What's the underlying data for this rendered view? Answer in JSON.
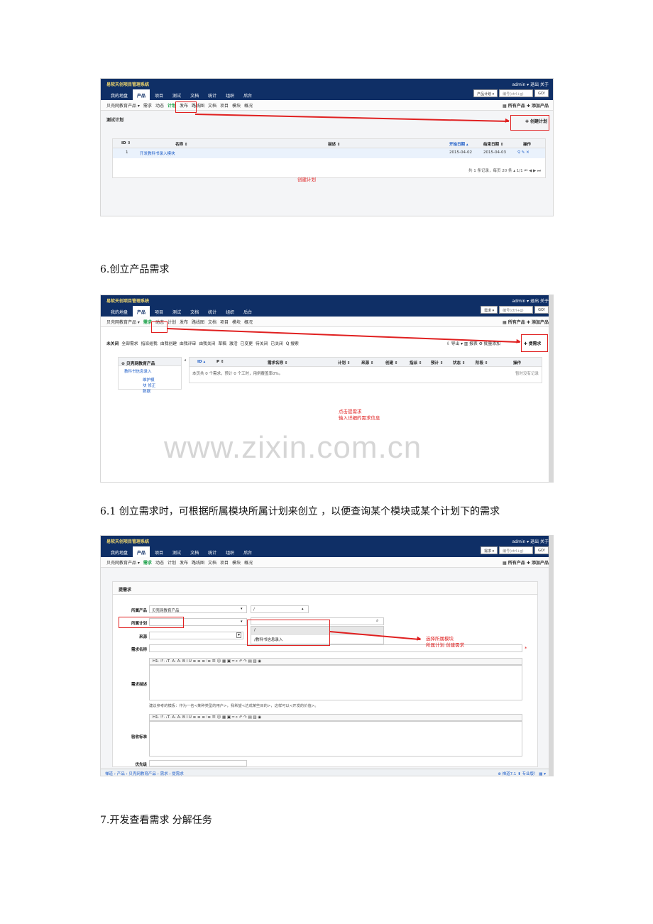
{
  "app": {
    "title": "易软天创项目管理系统",
    "user_menu": "admin ▾  退出  关于",
    "nav": [
      "我的地盘",
      "产品",
      "项目",
      "测试",
      "文档",
      "统计",
      "组织",
      "后台"
    ],
    "go": "GO!",
    "search_placeholder": "编号(ctrl+g)"
  },
  "shot1": {
    "search_type": "产品计划 ▾",
    "subnav": [
      "贝壳网教育产品 ▾",
      "需求",
      "动态",
      "计划",
      "发布",
      "路线图",
      "文档",
      "项目",
      "模块",
      "概况"
    ],
    "right_links": "▦ 所有产品  ✚ 添加产品",
    "panel_title": "测试计划",
    "create_btn": "✚ 创建计划",
    "columns": [
      "ID ⇕",
      "名称 ⇕",
      "描述 ⇕",
      "开始日期 ▴",
      "结束日期 ⇕",
      "操作"
    ],
    "row": [
      "1",
      "开发教科书录入模块",
      "",
      "2015-04-02",
      "2015-04-03",
      "⚲ ✎ ✕"
    ],
    "pager": "共 1 条记录，每页 20 条 ▴  1/1   ⏮  ◀  ▶  ⏭",
    "annotation": "创建计划"
  },
  "heading6": "6.创立产品需求",
  "shot2": {
    "search_type": "需求 ▾",
    "subnav": [
      "贝壳网教育产品 ▾",
      "需求",
      "动态",
      "计划",
      "发布",
      "路线图",
      "文档",
      "项目",
      "模块",
      "概况"
    ],
    "right_links": "▦ 所有产品  ✚ 添加产品",
    "filters": [
      "未关闭",
      "全部需求",
      "指派给我",
      "由我创建",
      "由我评审",
      "由我关闭",
      "草稿",
      "激活",
      "已变更",
      "待关闭",
      "已关闭",
      "Q 搜索"
    ],
    "actions": "⇩ 导出 ▾   ▥ 报表   ⚙ 批量添加",
    "create_btn": "✚ 提需求",
    "tree_title": "⊖ 贝壳网教育产品",
    "tree_item": "教科书信息录入",
    "tree_links": "维护模块 修正数据",
    "columns": [
      "ID ▴",
      "P ⇕",
      "需求名称 ⇕",
      "计划 ⇕",
      "来源 ⇕",
      "创建 ⇕",
      "指派 ⇕",
      "预计 ⇕",
      "状态 ⇕",
      "阶段 ⇕",
      "操作"
    ],
    "summary": "本页共 0 个需求，预计 0 个工时，用例覆盖率0%。",
    "no_records": "暂时没有记录",
    "annotation": [
      "点击提需求",
      "输入详细的需求信息"
    ],
    "watermark": "www.zixin.com.cn"
  },
  "heading61": "6.1 创立需求时，可根据所属模块所属计划来创立 ，以便查询某个模块或某个计划下的需求",
  "shot3": {
    "search_type": "需求 ▾",
    "subnav": [
      "贝壳网教育产品 ▾",
      "需求",
      "动态",
      "计划",
      "发布",
      "路线图",
      "文档",
      "项目",
      "模块",
      "概况"
    ],
    "right_links": "▦ 所有产品  ✚ 添加产品",
    "form_title": "提需求",
    "labels": [
      "所属产品",
      "所属计划",
      "来源",
      "需求名称",
      "需求描述",
      "验收标准",
      "优先级"
    ],
    "product_value": "贝壳网教育产品",
    "module_value": "/",
    "dropdown_items": [
      "/",
      "/教科书信息录入"
    ],
    "editor_toolbar": "H1·  ℱ·  ₜT·   A·  A·  B  I  U   ≡  ≡  ≡  ⁝≡  ☰   ☺  ▦  ▣  ═   ⌕  ↶  ↷  ▤  ▥  ◉",
    "template_hint": "建议参考的模板：作为一名<某种类型的用户>，我希望<达成某些目的>，这样可以<开发的价值>。",
    "required": "*",
    "annotation": [
      "选择所属模块",
      "所属计划 创建需求"
    ],
    "status_left": "禅道 › 产品 › 贝壳网教育产品 › 需求 › 提需求",
    "status_right": "⊕ 禅道7.1   ⬆ 专业版！  ▦ ▾"
  },
  "heading7": "7.开发查看需求  分解任务"
}
